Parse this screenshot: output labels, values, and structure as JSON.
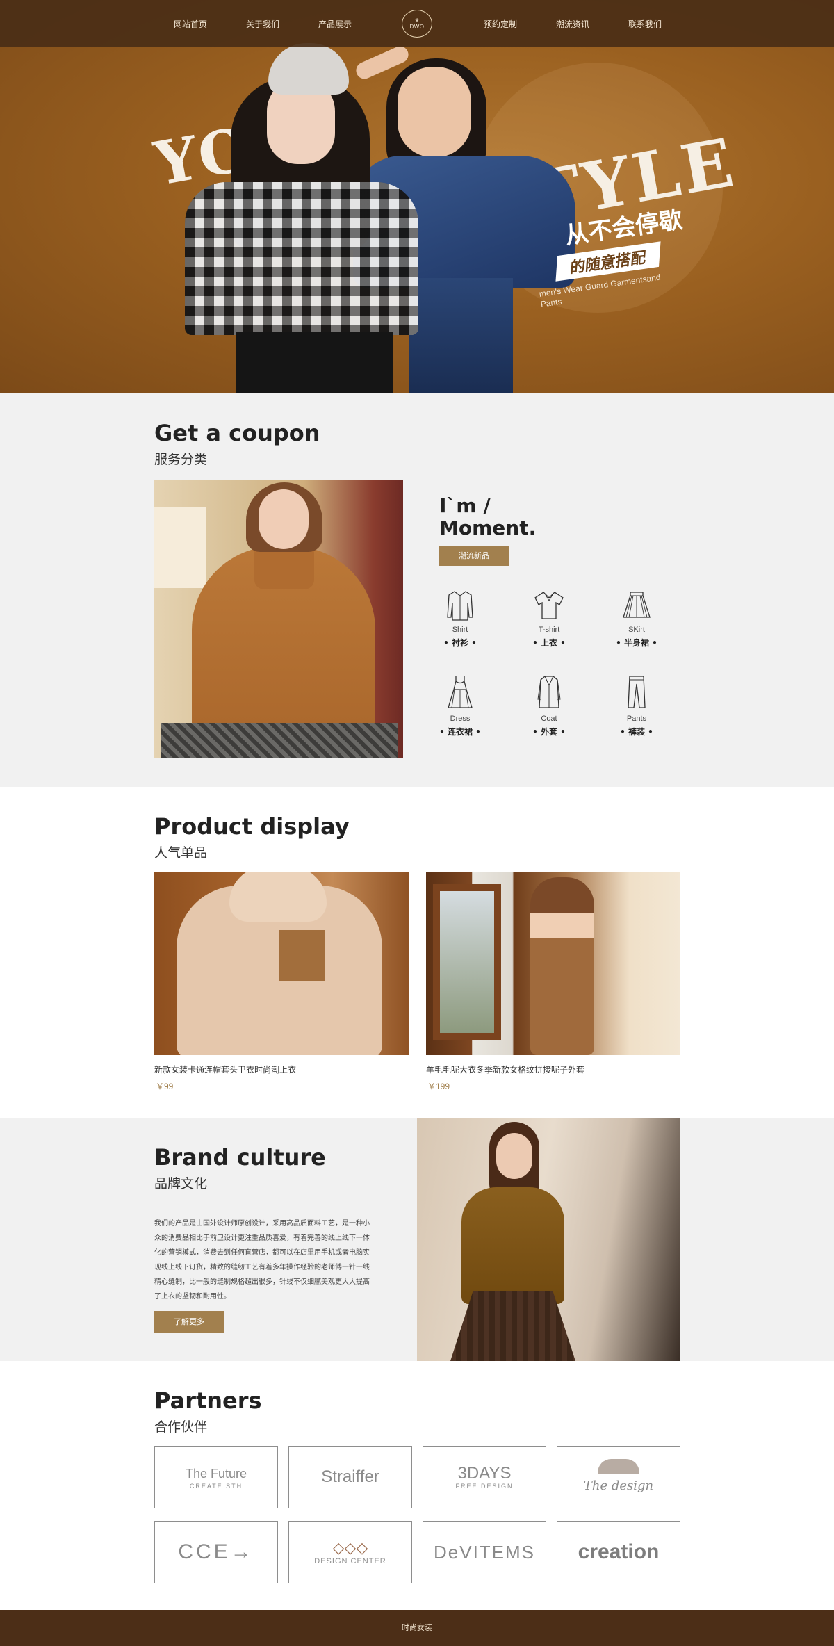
{
  "nav": {
    "items": [
      "网站首页",
      "关于我们",
      "产品展示",
      "预约定制",
      "潮流资讯",
      "联系我们"
    ],
    "logo": "DWO"
  },
  "hero": {
    "word_left": "YOU",
    "word_right": "STYLE",
    "slogan_main": "从不会停歇",
    "slogan_banner": "的随意搭配",
    "slogan_en": "men's Wear Guard Garmentsand Pants"
  },
  "coupon": {
    "title": "Get a coupon",
    "subtitle": "服务分类",
    "moment_line1": "I`m /",
    "moment_line2": "Moment.",
    "button": "潮流新品",
    "categories": [
      {
        "en": "Shirt",
        "zh": "• 衬衫 •",
        "icon": "shirt-icon"
      },
      {
        "en": "T-shirt",
        "zh": "• 上衣 •",
        "icon": "tshirt-icon"
      },
      {
        "en": "SKirt",
        "zh": "• 半身裙 •",
        "icon": "skirt-icon"
      },
      {
        "en": "Dress",
        "zh": "• 连衣裙 •",
        "icon": "dress-icon"
      },
      {
        "en": "Coat",
        "zh": "• 外套 •",
        "icon": "coat-icon"
      },
      {
        "en": "Pants",
        "zh": "• 裤装 •",
        "icon": "pants-icon"
      }
    ]
  },
  "products": {
    "title": "Product display",
    "subtitle": "人气单品",
    "items": [
      {
        "name": "新款女装卡通连帽套头卫衣时尚潮上衣",
        "price": "￥99"
      },
      {
        "name": "羊毛毛呢大衣冬季新款女格纹拼接呢子外套",
        "price": "￥199"
      }
    ]
  },
  "brand": {
    "title": "Brand culture",
    "subtitle": "品牌文化",
    "text": "我们的产品是由国外设计师原创设计，采用高品质面料工艺，是一种小众的消费品相比于前卫设计更注重品质喜爱，有着完善的线上线下一体化的营销模式，消费去到任何直营店，都可以在店里用手机或者电脑实现线上线下订货，精致的缝纫工艺有着多年操作经验的老师傅一针一线精心缝制，比一般的缝制规格超出很多，针线不仅细腻美观更大大提高了上衣的坚韧和耐用性。",
    "button": "了解更多"
  },
  "partners": {
    "title": "Partners",
    "subtitle": "合作伙伴",
    "logos": [
      {
        "main": "The Future",
        "sub": "CREATE STH"
      },
      {
        "main": "Straiffer",
        "sub": ""
      },
      {
        "main": "3DAYS",
        "sub": "FREE DESIGN"
      },
      {
        "main": "The design",
        "sub": ""
      },
      {
        "main": "CCE→",
        "sub": ""
      },
      {
        "main": "◇◇◇",
        "sub": "DESIGN CENTER"
      },
      {
        "main": "DeVITEMS",
        "sub": ""
      },
      {
        "main": "creation",
        "sub": ""
      }
    ]
  },
  "footer": {
    "text": "时尚女装"
  },
  "colors": {
    "nav_bg": "#4a2e16",
    "accent": "#a2804e",
    "footer_bg": "#4c2e17",
    "section_gray": "#f1f1f1"
  }
}
